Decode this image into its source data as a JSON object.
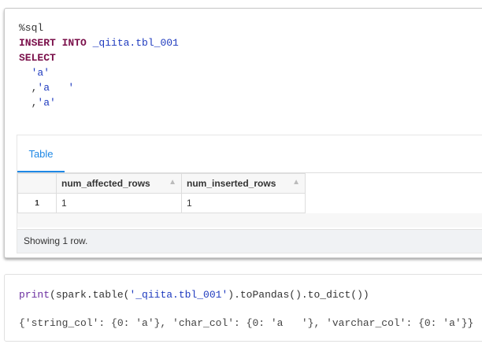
{
  "cell1": {
    "code": {
      "magic": "%sql",
      "kw1": "INSERT INTO",
      "table": " _qiita.tbl_001",
      "kw2": "SELECT",
      "v1": "'a'",
      "v2": "'a   '",
      "v3": "'a'"
    },
    "output": {
      "tab": "Table",
      "columns": [
        "num_affected_rows",
        "num_inserted_rows"
      ],
      "rows": [
        {
          "index": "1",
          "values": [
            "1",
            "1"
          ]
        }
      ],
      "footer": "Showing 1 row."
    }
  },
  "cell2": {
    "code": {
      "fn": "print",
      "p1": "(spark.table(",
      "str": "'_qiita.tbl_001'",
      "p2": ").toPandas().to_dict())"
    },
    "output": "{'string_col': {0: 'a'}, 'char_col': {0: 'a   '}, 'varchar_col': {0: 'a'}}"
  }
}
